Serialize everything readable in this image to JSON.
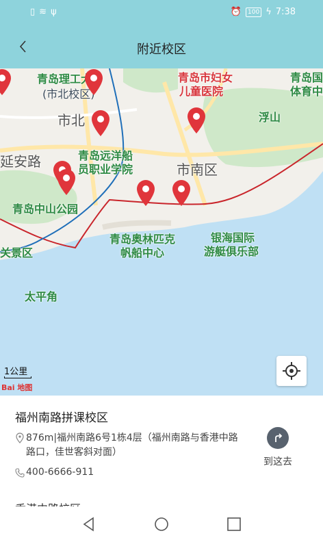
{
  "status_bar": {
    "battery": "100",
    "time": "7:38"
  },
  "header": {
    "title": "附近校区",
    "back_icon": "chevron-left-icon"
  },
  "colors": {
    "header_bg": "#8ed3dc",
    "water": "#bfe0f4",
    "land": "#f2f0eb",
    "park": "#cfe8c9",
    "pin": "#e0353b"
  },
  "map": {
    "labels": [
      "青岛理工大学",
      "(市北校区)",
      "市北",
      "青岛市妇女",
      "儿童医院",
      "青岛国",
      "体育中",
      "浮山",
      "延安路",
      "青岛远洋船",
      "员职业学院",
      "市南区",
      "青岛中山公园",
      "青岛奥林匹克",
      "帆船中心",
      "银海国际",
      "游艇俱乐部",
      "关景区",
      "太平角"
    ],
    "scale_label": "1公里",
    "provider_logo": "Bai 地图",
    "pin_count": 7
  },
  "campus": {
    "name": "福州南路拼课校区",
    "address": "876m|福州南路6号1栋4层（福州南路与香港中路路口，佳世客斜对面）",
    "phone": "400-6666-911",
    "navigate_label": "到这去"
  },
  "next_campus": {
    "name": "香港中路校区"
  }
}
